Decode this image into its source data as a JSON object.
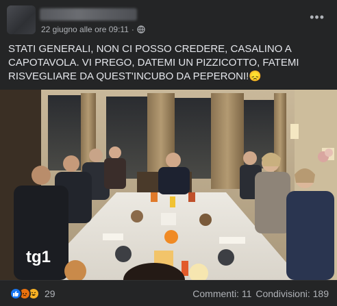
{
  "post": {
    "date": "22 giugno alle ore 09:11",
    "separator": "·",
    "more_label": "•••",
    "text": "STATI GENERALI, NON CI POSSO CREDERE, CASALINO A CAPOTAVOLA. VI PREGO, DATEMI UN PIZZICOTTO, FATEMI RISVEGLIARE DA QUEST'INCUBO DA PEPERONI!😞",
    "image_watermark": "tg1"
  },
  "footer": {
    "reaction_count": "29",
    "comments": "Commenti: 11",
    "shares": "Condivisioni: 189"
  },
  "icons": [
    "globe-icon",
    "more-icon",
    "like-reaction-icon",
    "angry-reaction-icon",
    "haha-reaction-icon"
  ],
  "colors": {
    "background": "#242526",
    "text": "#e4e6eb",
    "muted": "#b0b3b8",
    "like": "#1877f2"
  }
}
